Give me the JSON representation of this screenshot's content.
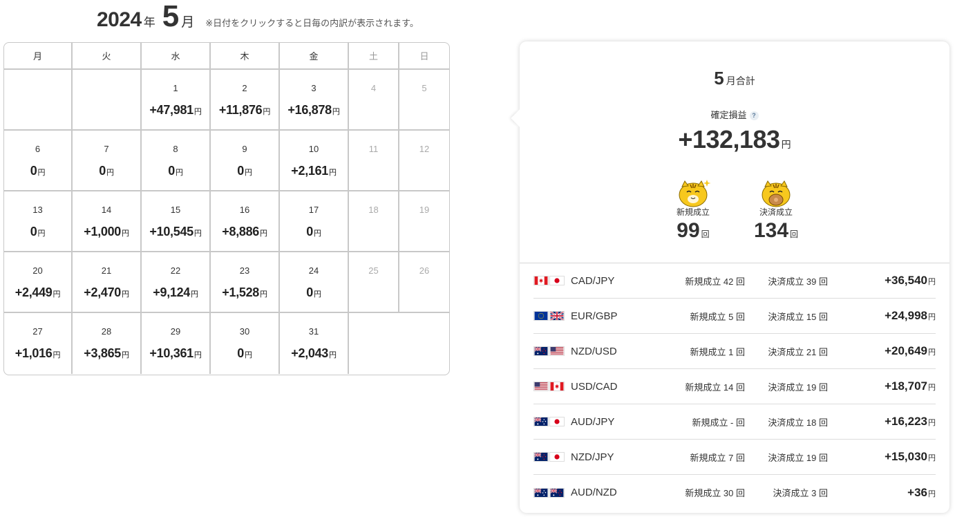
{
  "header": {
    "year": "2024",
    "year_unit": "年",
    "month": "5",
    "month_unit": "月",
    "note": "※日付をクリックすると日毎の内訳が表示されます。"
  },
  "weekdays": [
    "月",
    "火",
    "水",
    "木",
    "金",
    "土",
    "日"
  ],
  "days": [
    {
      "day": "",
      "amount": ""
    },
    {
      "day": "",
      "amount": ""
    },
    {
      "day": "1",
      "amount": "+47,981",
      "unit": "円"
    },
    {
      "day": "2",
      "amount": "+11,876",
      "unit": "円"
    },
    {
      "day": "3",
      "amount": "+16,878",
      "unit": "円"
    },
    {
      "day": "4",
      "amount": ""
    },
    {
      "day": "5",
      "amount": ""
    },
    {
      "day": "6",
      "amount": "0",
      "unit": "円"
    },
    {
      "day": "7",
      "amount": "0",
      "unit": "円"
    },
    {
      "day": "8",
      "amount": "0",
      "unit": "円"
    },
    {
      "day": "9",
      "amount": "0",
      "unit": "円"
    },
    {
      "day": "10",
      "amount": "+2,161",
      "unit": "円"
    },
    {
      "day": "11",
      "amount": ""
    },
    {
      "day": "12",
      "amount": ""
    },
    {
      "day": "13",
      "amount": "0",
      "unit": "円"
    },
    {
      "day": "14",
      "amount": "+1,000",
      "unit": "円"
    },
    {
      "day": "15",
      "amount": "+10,545",
      "unit": "円"
    },
    {
      "day": "16",
      "amount": "+8,886",
      "unit": "円"
    },
    {
      "day": "17",
      "amount": "0",
      "unit": "円"
    },
    {
      "day": "18",
      "amount": ""
    },
    {
      "day": "19",
      "amount": ""
    },
    {
      "day": "20",
      "amount": "+2,449",
      "unit": "円"
    },
    {
      "day": "21",
      "amount": "+2,470",
      "unit": "円"
    },
    {
      "day": "22",
      "amount": "+9,124",
      "unit": "円"
    },
    {
      "day": "23",
      "amount": "+1,528",
      "unit": "円"
    },
    {
      "day": "24",
      "amount": "0",
      "unit": "円"
    },
    {
      "day": "25",
      "amount": ""
    },
    {
      "day": "26",
      "amount": ""
    },
    {
      "day": "27",
      "amount": "+1,016",
      "unit": "円"
    },
    {
      "day": "28",
      "amount": "+3,865",
      "unit": "円"
    },
    {
      "day": "29",
      "amount": "+10,361",
      "unit": "円"
    },
    {
      "day": "30",
      "amount": "0",
      "unit": "円"
    },
    {
      "day": "31",
      "amount": "+2,043",
      "unit": "円"
    }
  ],
  "summary": {
    "month": "5",
    "title_suffix": "月合計",
    "pl_label": "確定損益",
    "help": "?",
    "pl_value": "+132,183",
    "yen": "円",
    "new_label": "新規成立",
    "new_count": "99",
    "close_label": "決済成立",
    "close_count": "134",
    "count_unit": "回"
  },
  "pairs": [
    {
      "name": "CAD/JPY",
      "flags": [
        "ca",
        "jp"
      ],
      "new": "新規成立 42 回",
      "close": "決済成立 39 回",
      "amount": "+36,540",
      "unit": "円"
    },
    {
      "name": "EUR/GBP",
      "flags": [
        "eu",
        "gb"
      ],
      "new": "新規成立 5 回",
      "close": "決済成立 15 回",
      "amount": "+24,998",
      "unit": "円"
    },
    {
      "name": "NZD/USD",
      "flags": [
        "nz",
        "us"
      ],
      "new": "新規成立 1 回",
      "close": "決済成立 21 回",
      "amount": "+20,649",
      "unit": "円"
    },
    {
      "name": "USD/CAD",
      "flags": [
        "us",
        "ca"
      ],
      "new": "新規成立 14 回",
      "close": "決済成立 19 回",
      "amount": "+18,707",
      "unit": "円"
    },
    {
      "name": "AUD/JPY",
      "flags": [
        "au",
        "jp"
      ],
      "new": "新規成立 - 回",
      "close": "決済成立 18 回",
      "amount": "+16,223",
      "unit": "円"
    },
    {
      "name": "NZD/JPY",
      "flags": [
        "nz",
        "jp"
      ],
      "new": "新規成立 7 回",
      "close": "決済成立 19 回",
      "amount": "+15,030",
      "unit": "円"
    },
    {
      "name": "AUD/NZD",
      "flags": [
        "au",
        "nz"
      ],
      "new": "新規成立 30 回",
      "close": "決済成立 3 回",
      "amount": "+36",
      "unit": "円"
    }
  ]
}
